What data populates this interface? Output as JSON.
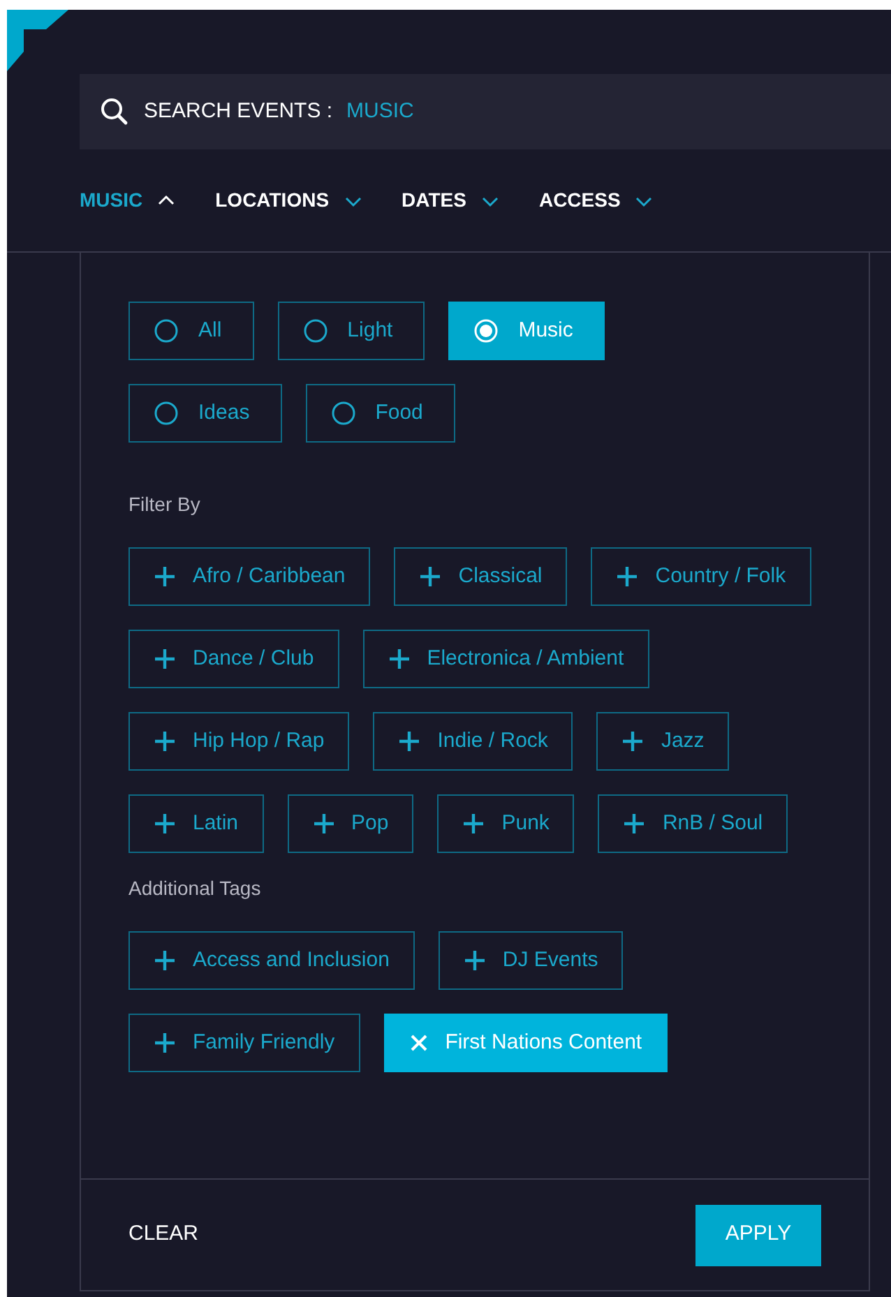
{
  "search": {
    "label": "SEARCH EVENTS :",
    "value": "MUSIC"
  },
  "nav_tabs": [
    {
      "label": "MUSIC",
      "expanded": true
    },
    {
      "label": "LOCATIONS",
      "expanded": false
    },
    {
      "label": "DATES",
      "expanded": false
    },
    {
      "label": "ACCESS",
      "expanded": false
    }
  ],
  "categories": [
    {
      "label": "All",
      "selected": false
    },
    {
      "label": "Light",
      "selected": false
    },
    {
      "label": "Music",
      "selected": true
    },
    {
      "label": "Ideas",
      "selected": false
    },
    {
      "label": "Food",
      "selected": false
    }
  ],
  "filter_by": {
    "heading": "Filter By",
    "tags": [
      {
        "label": "Afro / Caribbean",
        "selected": false
      },
      {
        "label": "Classical",
        "selected": false
      },
      {
        "label": "Country / Folk",
        "selected": false
      },
      {
        "label": "Dance / Club",
        "selected": false
      },
      {
        "label": "Electronica / Ambient",
        "selected": false
      },
      {
        "label": "Hip Hop / Rap",
        "selected": false
      },
      {
        "label": "Indie / Rock",
        "selected": false
      },
      {
        "label": "Jazz",
        "selected": false
      },
      {
        "label": "Latin",
        "selected": false
      },
      {
        "label": "Pop",
        "selected": false
      },
      {
        "label": "Punk",
        "selected": false
      },
      {
        "label": "RnB / Soul",
        "selected": false
      }
    ]
  },
  "additional_tags": {
    "heading": "Additional Tags",
    "tags": [
      {
        "label": "Access and Inclusion",
        "selected": false
      },
      {
        "label": "DJ Events",
        "selected": false
      },
      {
        "label": "Family Friendly",
        "selected": false
      },
      {
        "label": "First Nations Content",
        "selected": true
      }
    ]
  },
  "footer": {
    "clear": "CLEAR",
    "apply": "APPLY"
  }
}
